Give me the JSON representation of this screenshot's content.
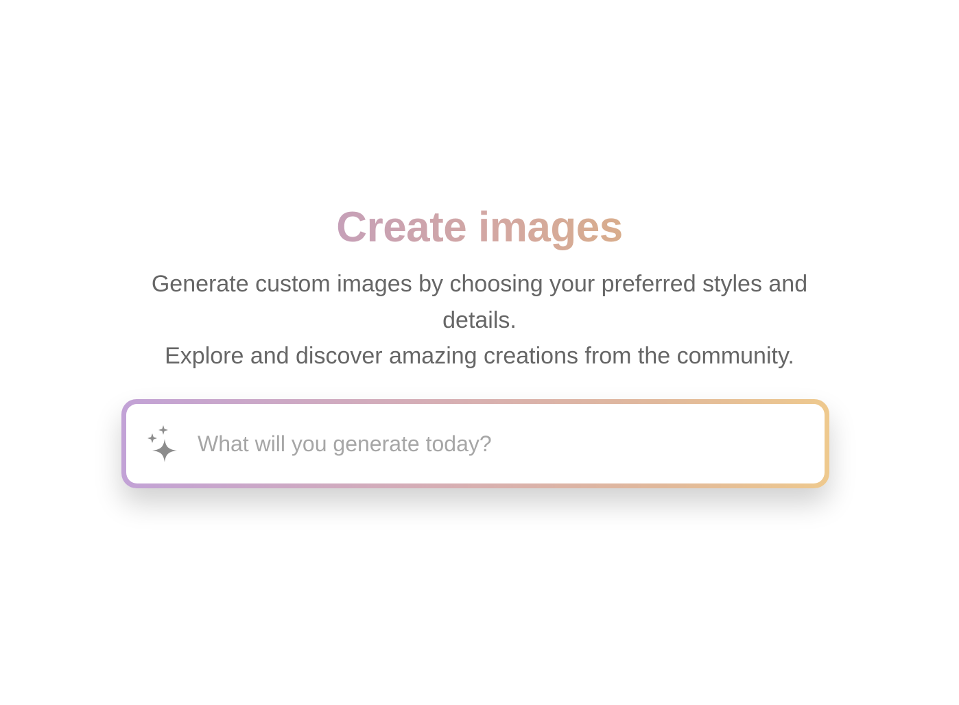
{
  "hero": {
    "title": "Create images",
    "subtitle_line1": "Generate custom images by choosing your preferred styles and details.",
    "subtitle_line2": "Explore and discover amazing creations from the community."
  },
  "prompt": {
    "placeholder": "What will you generate today?",
    "value": "",
    "icon": "sparkles-icon"
  },
  "colors": {
    "title_gradient": [
      "#c6a0b8",
      "#d8ad8c"
    ],
    "border_gradient": [
      "#c2a2d6",
      "#eec98e"
    ],
    "text": "#666666",
    "placeholder": "#a6a6a6",
    "icon": "#8c8c8c"
  }
}
